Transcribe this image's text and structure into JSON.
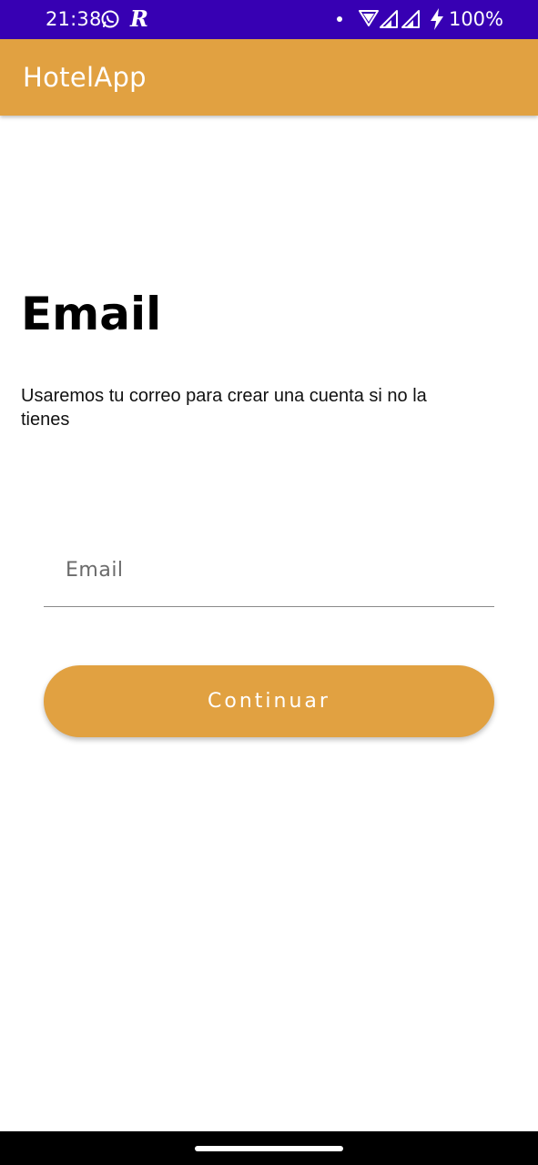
{
  "status_bar": {
    "time": "21:38",
    "battery": "100%",
    "icons": [
      "whatsapp-icon",
      "r-app-icon",
      "notification-dot-icon",
      "wifi-icon",
      "signal-icon",
      "signal-icon-2",
      "charging-bolt-icon"
    ]
  },
  "app_bar": {
    "title": "HotelApp"
  },
  "main": {
    "heading": "Email",
    "subtitle": "Usaremos tu correo para crear una cuenta si no la tienes",
    "email_input": {
      "placeholder": "Email",
      "value": ""
    },
    "continue_label": "Continuar"
  },
  "colors": {
    "status_bar": "#3700b3",
    "accent": "#e1a141",
    "background": "#ffffff"
  }
}
